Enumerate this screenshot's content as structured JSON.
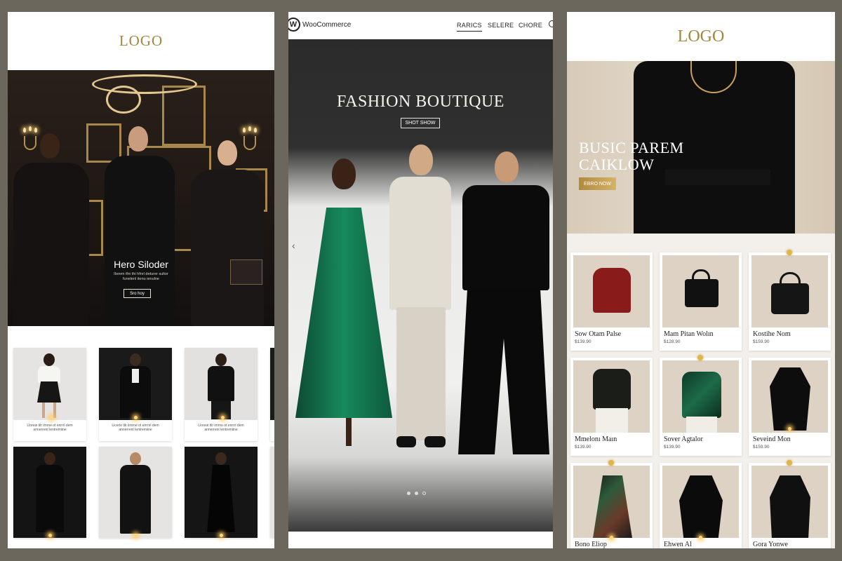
{
  "panel1": {
    "logo": "LOGO",
    "hero": {
      "title": "Hero Siloder",
      "subtitle": "Ilorem ifm thi hfnrl deturer sultor\nfunelenl itenu ienulne",
      "button": "Sro hoy"
    },
    "cards": [
      {
        "caption": "Lloreie tilr imrne ot enrrrl dem\nannerrent lentremiine"
      },
      {
        "caption": "Licerle tilr iimrne ot enrnrl dem\nannerrent lentremiine"
      },
      {
        "caption": "Lloreie tilr imrne ot enrrrl dem\nannerrent lentremiine"
      }
    ]
  },
  "panel2": {
    "brand": "WooCommerce",
    "nav": [
      {
        "label": "RARICS",
        "active": true
      },
      {
        "label": "SELERE",
        "active": false
      },
      {
        "label": "CHORE",
        "active": false
      }
    ],
    "hero": {
      "title": "FASHION BOUTIQUE",
      "button": "SHOT SHOW"
    }
  },
  "panel3": {
    "logo": "LOGO",
    "hero": {
      "title_line1": "BUSIC PAREM",
      "title_line2": "CAIKLOW",
      "button": "EBRO NOW"
    },
    "products": [
      {
        "name": "Sow Otam Palse",
        "price": "$139.90"
      },
      {
        "name": "Mam Pitan Wolın",
        "price": "$128.90"
      },
      {
        "name": "Kostihe Nom",
        "price": "$159.90"
      },
      {
        "name": "Mmelonı Maın",
        "price": "$139.90"
      },
      {
        "name": "Sover Agtalor",
        "price": "$139.90"
      },
      {
        "name": "Seveind Mon",
        "price": "$159.90"
      },
      {
        "name": "Bono Eliop",
        "price": ""
      },
      {
        "name": "Ehwen Al",
        "price": ""
      },
      {
        "name": "Gora Yonwe",
        "price": ""
      }
    ]
  },
  "colors": {
    "background": "#6b675c",
    "gold": "#a38640",
    "accent_button": "#c39e52"
  },
  "icons": [
    "woocommerce-logo-icon",
    "search-icon",
    "chevron-left-icon",
    "carousel-dot-icon"
  ]
}
